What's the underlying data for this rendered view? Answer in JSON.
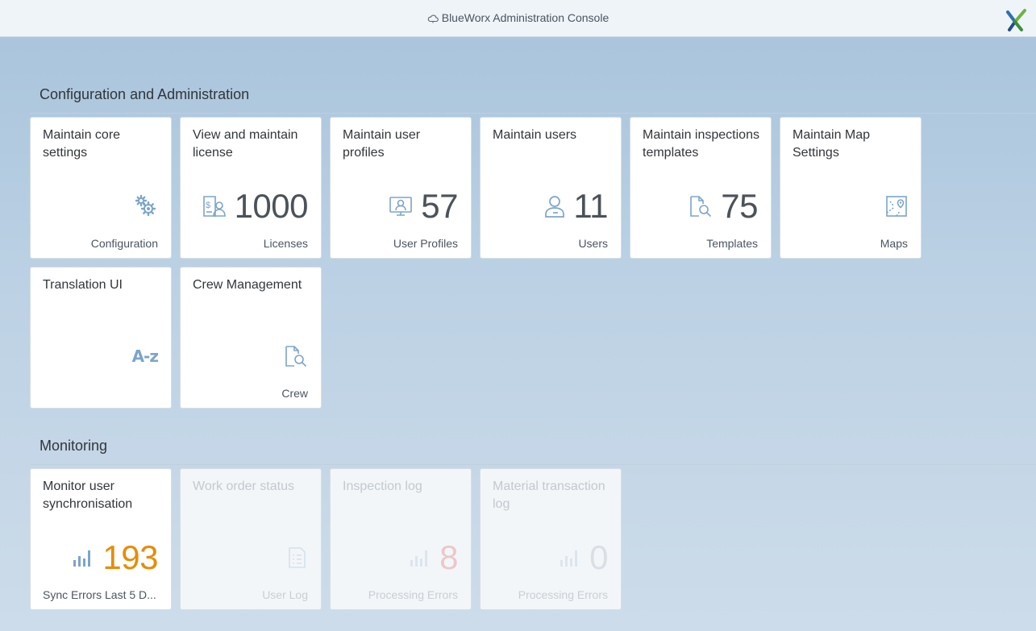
{
  "app": {
    "title": "BlueWorx Administration Console"
  },
  "sections": {
    "config": {
      "title": "Configuration and Administration"
    },
    "monitoring": {
      "title": "Monitoring"
    }
  },
  "tiles": {
    "core_settings": {
      "title": "Maintain core settings",
      "footer": "Configuration",
      "icon": "gears-icon"
    },
    "license": {
      "title": "View and maintain license",
      "value": "1000",
      "footer": "Licenses",
      "icon": "license-icon"
    },
    "user_profiles": {
      "title": "Maintain user profiles",
      "value": "57",
      "footer": "User Profiles",
      "icon": "user-profile-icon"
    },
    "users": {
      "title": "Maintain users",
      "value": "11",
      "footer": "Users",
      "icon": "user-icon"
    },
    "templates": {
      "title": "Maintain inspections templates",
      "value": "75",
      "footer": "Templates",
      "icon": "document-search-icon"
    },
    "map_settings": {
      "title": "Maintain Map Settings",
      "footer": "Maps",
      "icon": "map-icon"
    },
    "translation": {
      "title": "Translation UI",
      "icon": "a-z-icon",
      "icon_text": "A-z"
    },
    "crew": {
      "title": "Crew Management",
      "footer": "Crew",
      "icon": "document-search-icon"
    },
    "sync": {
      "title": "Monitor user synchronisation",
      "value": "193",
      "footer": "Sync Errors Last 5 D...",
      "icon": "bar-chart-icon",
      "value_color": "#e78c07"
    },
    "work_order": {
      "title": "Work order status",
      "footer": "User Log",
      "icon": "list-document-icon"
    },
    "inspection_log": {
      "title": "Inspection log",
      "value": "8",
      "footer": "Processing Errors",
      "icon": "bar-chart-icon",
      "value_color": "#e8a3a3"
    },
    "material_log": {
      "title": "Material transaction log",
      "value": "0",
      "footer": "Processing Errors",
      "icon": "bar-chart-icon"
    }
  },
  "colors": {
    "icon_blue": "#7ba5cc",
    "kpi_default": "#4b5259",
    "kpi_critical": "#e78c07"
  }
}
